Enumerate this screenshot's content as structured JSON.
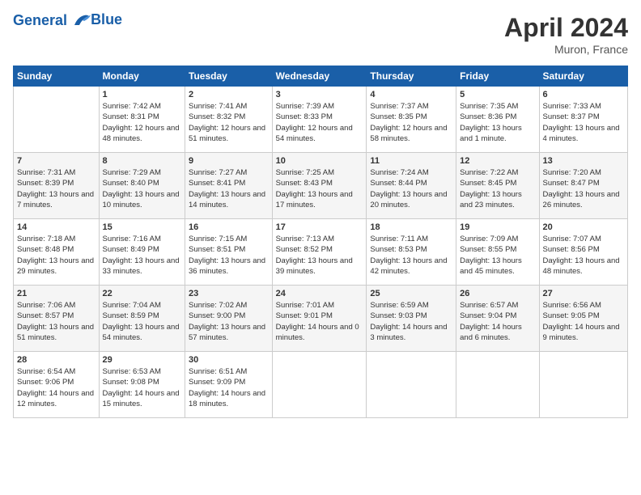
{
  "header": {
    "logo_line1": "General",
    "logo_line2": "Blue",
    "month": "April 2024",
    "location": "Muron, France"
  },
  "days_of_week": [
    "Sunday",
    "Monday",
    "Tuesday",
    "Wednesday",
    "Thursday",
    "Friday",
    "Saturday"
  ],
  "weeks": [
    [
      {
        "day": "",
        "info": ""
      },
      {
        "day": "1",
        "info": "Sunrise: 7:42 AM\nSunset: 8:31 PM\nDaylight: 12 hours and 48 minutes."
      },
      {
        "day": "2",
        "info": "Sunrise: 7:41 AM\nSunset: 8:32 PM\nDaylight: 12 hours and 51 minutes."
      },
      {
        "day": "3",
        "info": "Sunrise: 7:39 AM\nSunset: 8:33 PM\nDaylight: 12 hours and 54 minutes."
      },
      {
        "day": "4",
        "info": "Sunrise: 7:37 AM\nSunset: 8:35 PM\nDaylight: 12 hours and 58 minutes."
      },
      {
        "day": "5",
        "info": "Sunrise: 7:35 AM\nSunset: 8:36 PM\nDaylight: 13 hours and 1 minute."
      },
      {
        "day": "6",
        "info": "Sunrise: 7:33 AM\nSunset: 8:37 PM\nDaylight: 13 hours and 4 minutes."
      }
    ],
    [
      {
        "day": "7",
        "info": "Sunrise: 7:31 AM\nSunset: 8:39 PM\nDaylight: 13 hours and 7 minutes."
      },
      {
        "day": "8",
        "info": "Sunrise: 7:29 AM\nSunset: 8:40 PM\nDaylight: 13 hours and 10 minutes."
      },
      {
        "day": "9",
        "info": "Sunrise: 7:27 AM\nSunset: 8:41 PM\nDaylight: 13 hours and 14 minutes."
      },
      {
        "day": "10",
        "info": "Sunrise: 7:25 AM\nSunset: 8:43 PM\nDaylight: 13 hours and 17 minutes."
      },
      {
        "day": "11",
        "info": "Sunrise: 7:24 AM\nSunset: 8:44 PM\nDaylight: 13 hours and 20 minutes."
      },
      {
        "day": "12",
        "info": "Sunrise: 7:22 AM\nSunset: 8:45 PM\nDaylight: 13 hours and 23 minutes."
      },
      {
        "day": "13",
        "info": "Sunrise: 7:20 AM\nSunset: 8:47 PM\nDaylight: 13 hours and 26 minutes."
      }
    ],
    [
      {
        "day": "14",
        "info": "Sunrise: 7:18 AM\nSunset: 8:48 PM\nDaylight: 13 hours and 29 minutes."
      },
      {
        "day": "15",
        "info": "Sunrise: 7:16 AM\nSunset: 8:49 PM\nDaylight: 13 hours and 33 minutes."
      },
      {
        "day": "16",
        "info": "Sunrise: 7:15 AM\nSunset: 8:51 PM\nDaylight: 13 hours and 36 minutes."
      },
      {
        "day": "17",
        "info": "Sunrise: 7:13 AM\nSunset: 8:52 PM\nDaylight: 13 hours and 39 minutes."
      },
      {
        "day": "18",
        "info": "Sunrise: 7:11 AM\nSunset: 8:53 PM\nDaylight: 13 hours and 42 minutes."
      },
      {
        "day": "19",
        "info": "Sunrise: 7:09 AM\nSunset: 8:55 PM\nDaylight: 13 hours and 45 minutes."
      },
      {
        "day": "20",
        "info": "Sunrise: 7:07 AM\nSunset: 8:56 PM\nDaylight: 13 hours and 48 minutes."
      }
    ],
    [
      {
        "day": "21",
        "info": "Sunrise: 7:06 AM\nSunset: 8:57 PM\nDaylight: 13 hours and 51 minutes."
      },
      {
        "day": "22",
        "info": "Sunrise: 7:04 AM\nSunset: 8:59 PM\nDaylight: 13 hours and 54 minutes."
      },
      {
        "day": "23",
        "info": "Sunrise: 7:02 AM\nSunset: 9:00 PM\nDaylight: 13 hours and 57 minutes."
      },
      {
        "day": "24",
        "info": "Sunrise: 7:01 AM\nSunset: 9:01 PM\nDaylight: 14 hours and 0 minutes."
      },
      {
        "day": "25",
        "info": "Sunrise: 6:59 AM\nSunset: 9:03 PM\nDaylight: 14 hours and 3 minutes."
      },
      {
        "day": "26",
        "info": "Sunrise: 6:57 AM\nSunset: 9:04 PM\nDaylight: 14 hours and 6 minutes."
      },
      {
        "day": "27",
        "info": "Sunrise: 6:56 AM\nSunset: 9:05 PM\nDaylight: 14 hours and 9 minutes."
      }
    ],
    [
      {
        "day": "28",
        "info": "Sunrise: 6:54 AM\nSunset: 9:06 PM\nDaylight: 14 hours and 12 minutes."
      },
      {
        "day": "29",
        "info": "Sunrise: 6:53 AM\nSunset: 9:08 PM\nDaylight: 14 hours and 15 minutes."
      },
      {
        "day": "30",
        "info": "Sunrise: 6:51 AM\nSunset: 9:09 PM\nDaylight: 14 hours and 18 minutes."
      },
      {
        "day": "",
        "info": ""
      },
      {
        "day": "",
        "info": ""
      },
      {
        "day": "",
        "info": ""
      },
      {
        "day": "",
        "info": ""
      }
    ]
  ]
}
